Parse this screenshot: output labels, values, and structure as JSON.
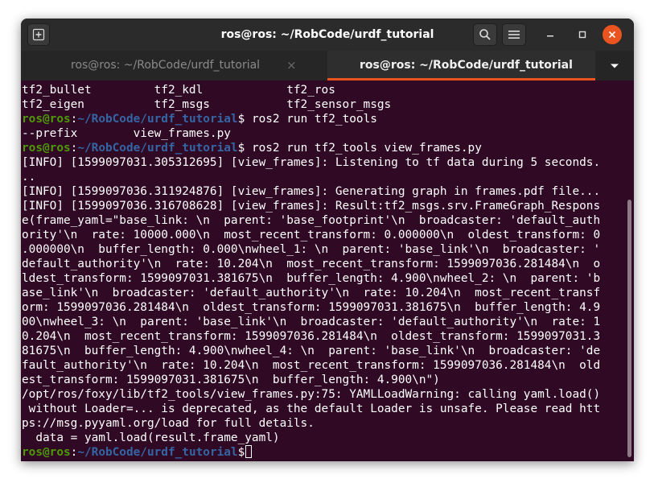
{
  "window": {
    "title": "ros@ros: ~/RobCode/urdf_tutorial"
  },
  "tabs": [
    {
      "label": "ros@ros: ~/RobCode/urdf_tutorial",
      "active": false,
      "close": "×"
    },
    {
      "label": "ros@ros: ~/RobCode/urdf_tutorial",
      "active": true
    }
  ],
  "icons": {
    "new_tab": "new-tab-icon",
    "search": "search-icon",
    "menu": "hamburger-menu-icon",
    "minimize": "minimize-icon",
    "maximize": "maximize-icon",
    "close": "close-icon",
    "tabs_dropdown": "chevron-down-icon"
  },
  "colors": {
    "terminal_bg": "#300a24",
    "prompt_user": "#4e9a06",
    "prompt_path": "#3465a4",
    "accent": "#e95420"
  },
  "terminal": {
    "prompt": {
      "user": "ros@ros",
      "sep": ":",
      "path": "~/RobCode/urdf_tutorial",
      "sym": "$"
    },
    "lines": [
      {
        "text": "tf2_bullet         tf2_kdl            tf2_ros"
      },
      {
        "text": "tf2_eigen          tf2_msgs           tf2_sensor_msgs"
      },
      {
        "cmd": " ros2 run tf2_tools"
      },
      {
        "text": "--prefix        view_frames.py"
      },
      {
        "cmd": " ros2 run tf2_tools view_frames.py"
      },
      {
        "text": "[INFO] [1599097031.305312695] [view_frames]: Listening to tf data during 5 seconds."
      },
      {
        "text": ".."
      },
      {
        "text": "[INFO] [1599097036.311924876] [view_frames]: Generating graph in frames.pdf file..."
      },
      {
        "text": "[INFO] [1599097036.316708628] [view_frames]: Result:tf2_msgs.srv.FrameGraph_Respons"
      },
      {
        "text": "e(frame_yaml=\"base_link: \\n  parent: 'base_footprint'\\n  broadcaster: 'default_auth"
      },
      {
        "text": "ority'\\n  rate: 10000.000\\n  most_recent_transform: 0.000000\\n  oldest_transform: 0"
      },
      {
        "text": ".000000\\n  buffer_length: 0.000\\nwheel_1: \\n  parent: 'base_link'\\n  broadcaster: '"
      },
      {
        "text": "default_authority'\\n  rate: 10.204\\n  most_recent_transform: 1599097036.281484\\n  o"
      },
      {
        "text": "ldest_transform: 1599097031.381675\\n  buffer_length: 4.900\\nwheel_2: \\n  parent: 'b"
      },
      {
        "text": "ase_link'\\n  broadcaster: 'default_authority'\\n  rate: 10.204\\n  most_recent_transf"
      },
      {
        "text": "orm: 1599097036.281484\\n  oldest_transform: 1599097031.381675\\n  buffer_length: 4.9"
      },
      {
        "text": "00\\nwheel_3: \\n  parent: 'base_link'\\n  broadcaster: 'default_authority'\\n  rate: 1"
      },
      {
        "text": "0.204\\n  most_recent_transform: 1599097036.281484\\n  oldest_transform: 1599097031.3"
      },
      {
        "text": "81675\\n  buffer_length: 4.900\\nwheel_4: \\n  parent: 'base_link'\\n  broadcaster: 'de"
      },
      {
        "text": "fault_authority'\\n  rate: 10.204\\n  most_recent_transform: 1599097036.281484\\n  old"
      },
      {
        "text": "est_transform: 1599097031.381675\\n  buffer_length: 4.900\\n\")"
      },
      {
        "text": "/opt/ros/foxy/lib/tf2_tools/view_frames.py:75: YAMLLoadWarning: calling yaml.load()"
      },
      {
        "text": " without Loader=... is deprecated, as the default Loader is unsafe. Please read htt"
      },
      {
        "text": "ps://msg.pyyaml.org/load for full details."
      },
      {
        "text": "  data = yaml.load(result.frame_yaml)"
      },
      {
        "cmd": " ",
        "cursor": true
      }
    ]
  }
}
